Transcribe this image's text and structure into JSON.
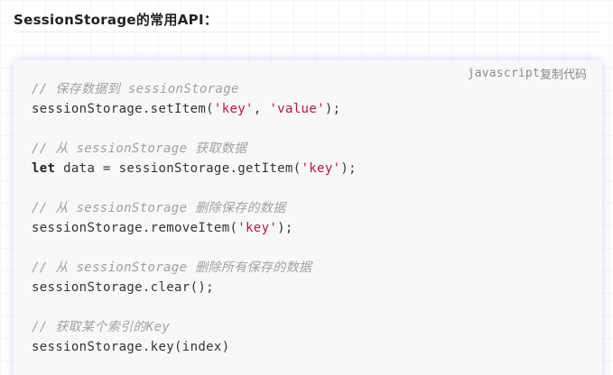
{
  "heading": "SessionStorage的常用API：",
  "code_block": {
    "language": "javascript",
    "copy_label": "复制代码",
    "colors": {
      "background": "#f8f8f8",
      "comment": "#a0a1a7",
      "string": "#c0143c",
      "text": "#333333"
    },
    "lines": {
      "l1_comment": "// 保存数据到 sessionStorage",
      "l2_a": "sessionStorage.setItem(",
      "l2_s1": "'key'",
      "l2_b": ", ",
      "l2_s2": "'value'",
      "l2_c": ");",
      "l4_comment": "// 从 sessionStorage 获取数据",
      "l5_kw": "let",
      "l5_a": " data = sessionStorage.getItem(",
      "l5_s1": "'key'",
      "l5_b": ");",
      "l7_comment": "// 从 sessionStorage 删除保存的数据",
      "l8_a": "sessionStorage.removeItem(",
      "l8_s1": "'key'",
      "l8_b": ");",
      "l10_comment": "// 从 sessionStorage 删除所有保存的数据",
      "l11_a": "sessionStorage.clear();",
      "l13_comment": "// 获取某个索引的Key",
      "l14_a": "sessionStorage.key(index)"
    }
  }
}
